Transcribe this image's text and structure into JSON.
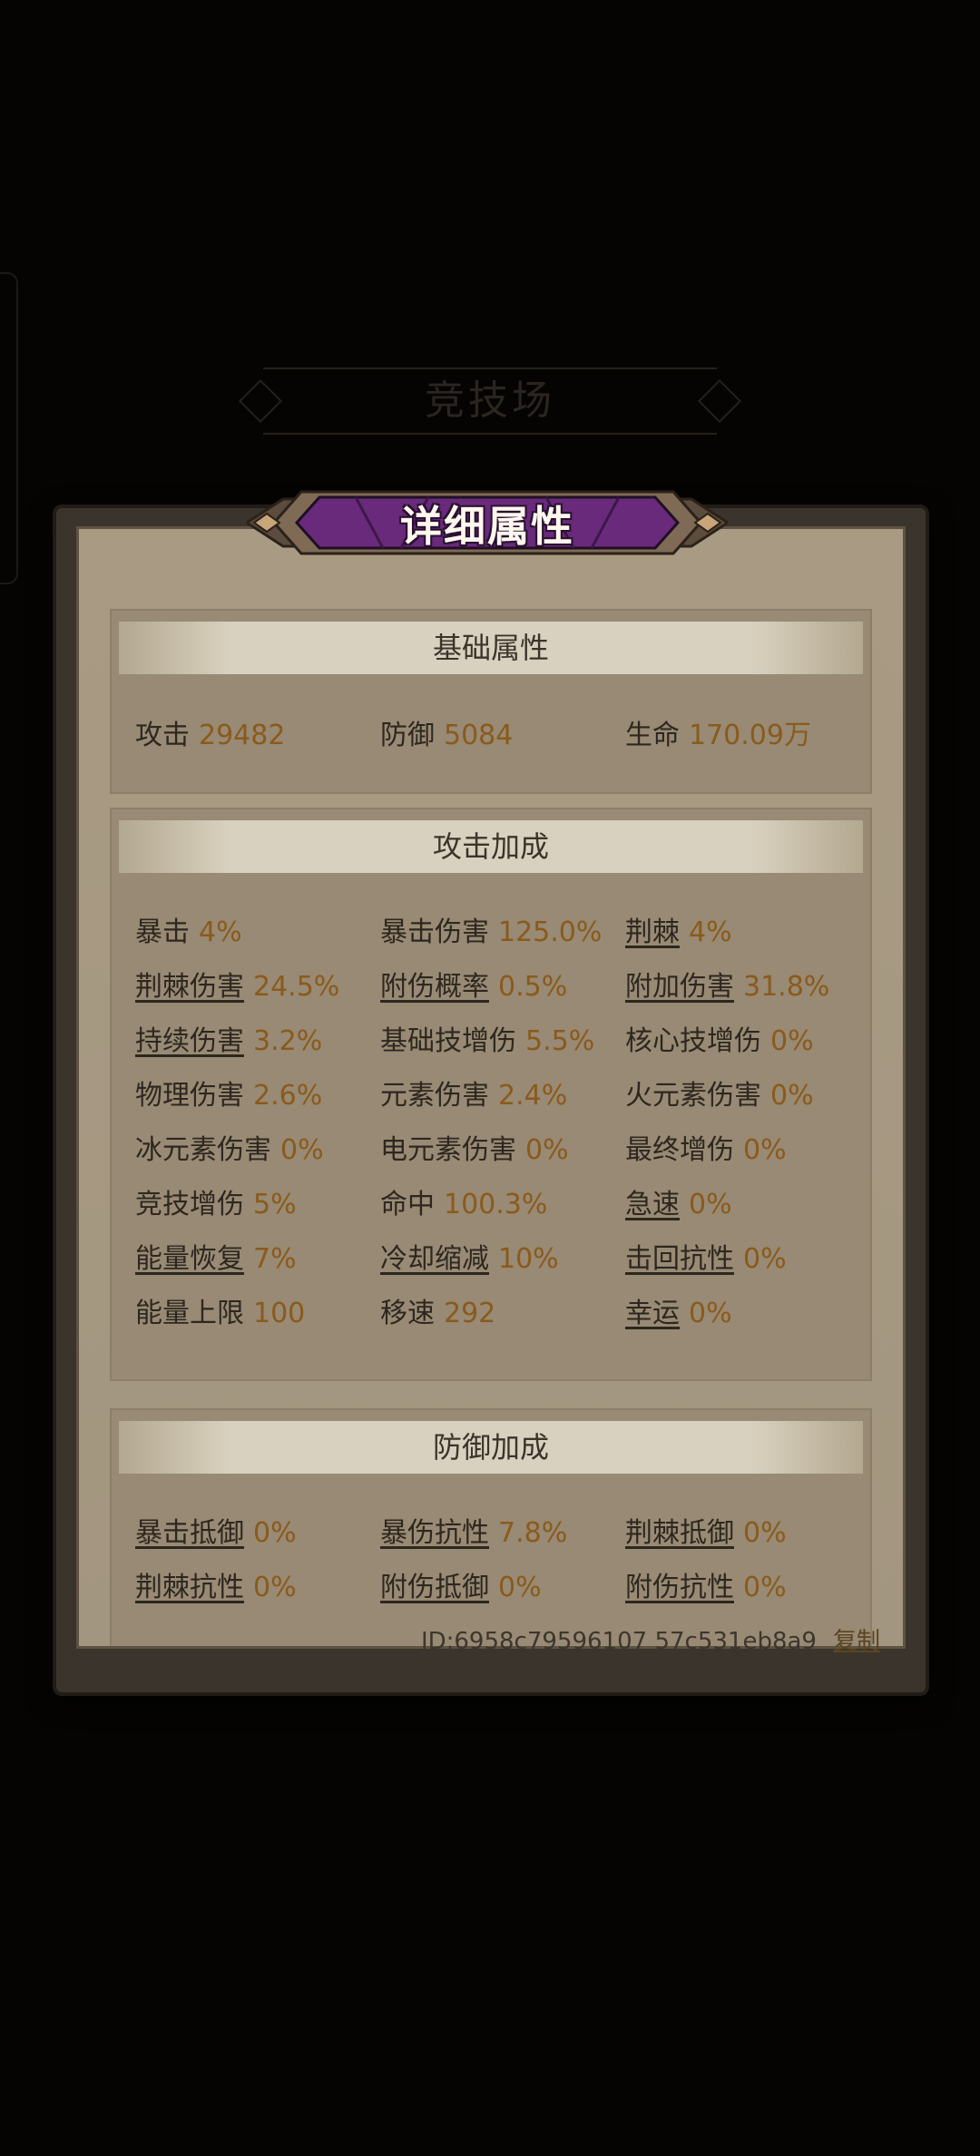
{
  "background": {
    "title": "竞技场"
  },
  "dialog": {
    "title": "详细属性",
    "sections": [
      {
        "title": "基础属性",
        "stats": [
          {
            "label": "攻击",
            "value": "29482",
            "link": false
          },
          {
            "label": "防御",
            "value": "5084",
            "link": false
          },
          {
            "label": "生命",
            "value": "170.09万",
            "link": false
          }
        ]
      },
      {
        "title": "攻击加成",
        "stats": [
          {
            "label": "暴击",
            "value": "4%",
            "link": false
          },
          {
            "label": "暴击伤害",
            "value": "125.0%",
            "link": false
          },
          {
            "label": "荆棘",
            "value": "4%",
            "link": true
          },
          {
            "label": "荆棘伤害",
            "value": "24.5%",
            "link": true
          },
          {
            "label": "附伤概率",
            "value": "0.5%",
            "link": true
          },
          {
            "label": "附加伤害",
            "value": "31.8%",
            "link": true
          },
          {
            "label": "持续伤害",
            "value": "3.2%",
            "link": true
          },
          {
            "label": "基础技增伤",
            "value": "5.5%",
            "link": false
          },
          {
            "label": "核心技增伤",
            "value": "0%",
            "link": false
          },
          {
            "label": "物理伤害",
            "value": "2.6%",
            "link": false
          },
          {
            "label": "元素伤害",
            "value": "2.4%",
            "link": false
          },
          {
            "label": "火元素伤害",
            "value": "0%",
            "link": false
          },
          {
            "label": "冰元素伤害",
            "value": "0%",
            "link": false
          },
          {
            "label": "电元素伤害",
            "value": "0%",
            "link": false
          },
          {
            "label": "最终增伤",
            "value": "0%",
            "link": false
          },
          {
            "label": "竞技增伤",
            "value": "5%",
            "link": false
          },
          {
            "label": "命中",
            "value": "100.3%",
            "link": false
          },
          {
            "label": "急速",
            "value": "0%",
            "link": true
          },
          {
            "label": "能量恢复",
            "value": "7%",
            "link": true
          },
          {
            "label": "冷却缩减",
            "value": "10%",
            "link": true
          },
          {
            "label": "击回抗性",
            "value": "0%",
            "link": true
          },
          {
            "label": "能量上限",
            "value": "100",
            "link": false
          },
          {
            "label": "移速",
            "value": "292",
            "link": false
          },
          {
            "label": "幸运",
            "value": "0%",
            "link": true
          }
        ]
      },
      {
        "title": "防御加成",
        "stats": [
          {
            "label": "暴击抵御",
            "value": "0%",
            "link": true
          },
          {
            "label": "暴伤抗性",
            "value": "7.8%",
            "link": true
          },
          {
            "label": "荆棘抵御",
            "value": "0%",
            "link": true
          },
          {
            "label": "荆棘抗性",
            "value": "0%",
            "link": true
          },
          {
            "label": "附伤抵御",
            "value": "0%",
            "link": true
          },
          {
            "label": "附伤抗性",
            "value": "0%",
            "link": true
          }
        ]
      }
    ]
  },
  "footer": {
    "id_text": "ID:6958c79596107 57c531eb8a9",
    "copy_label": "复制"
  },
  "colors": {
    "accent_purple": "#6a2a7c",
    "value_color": "#8a5a1c",
    "paper": "#a99b83"
  }
}
